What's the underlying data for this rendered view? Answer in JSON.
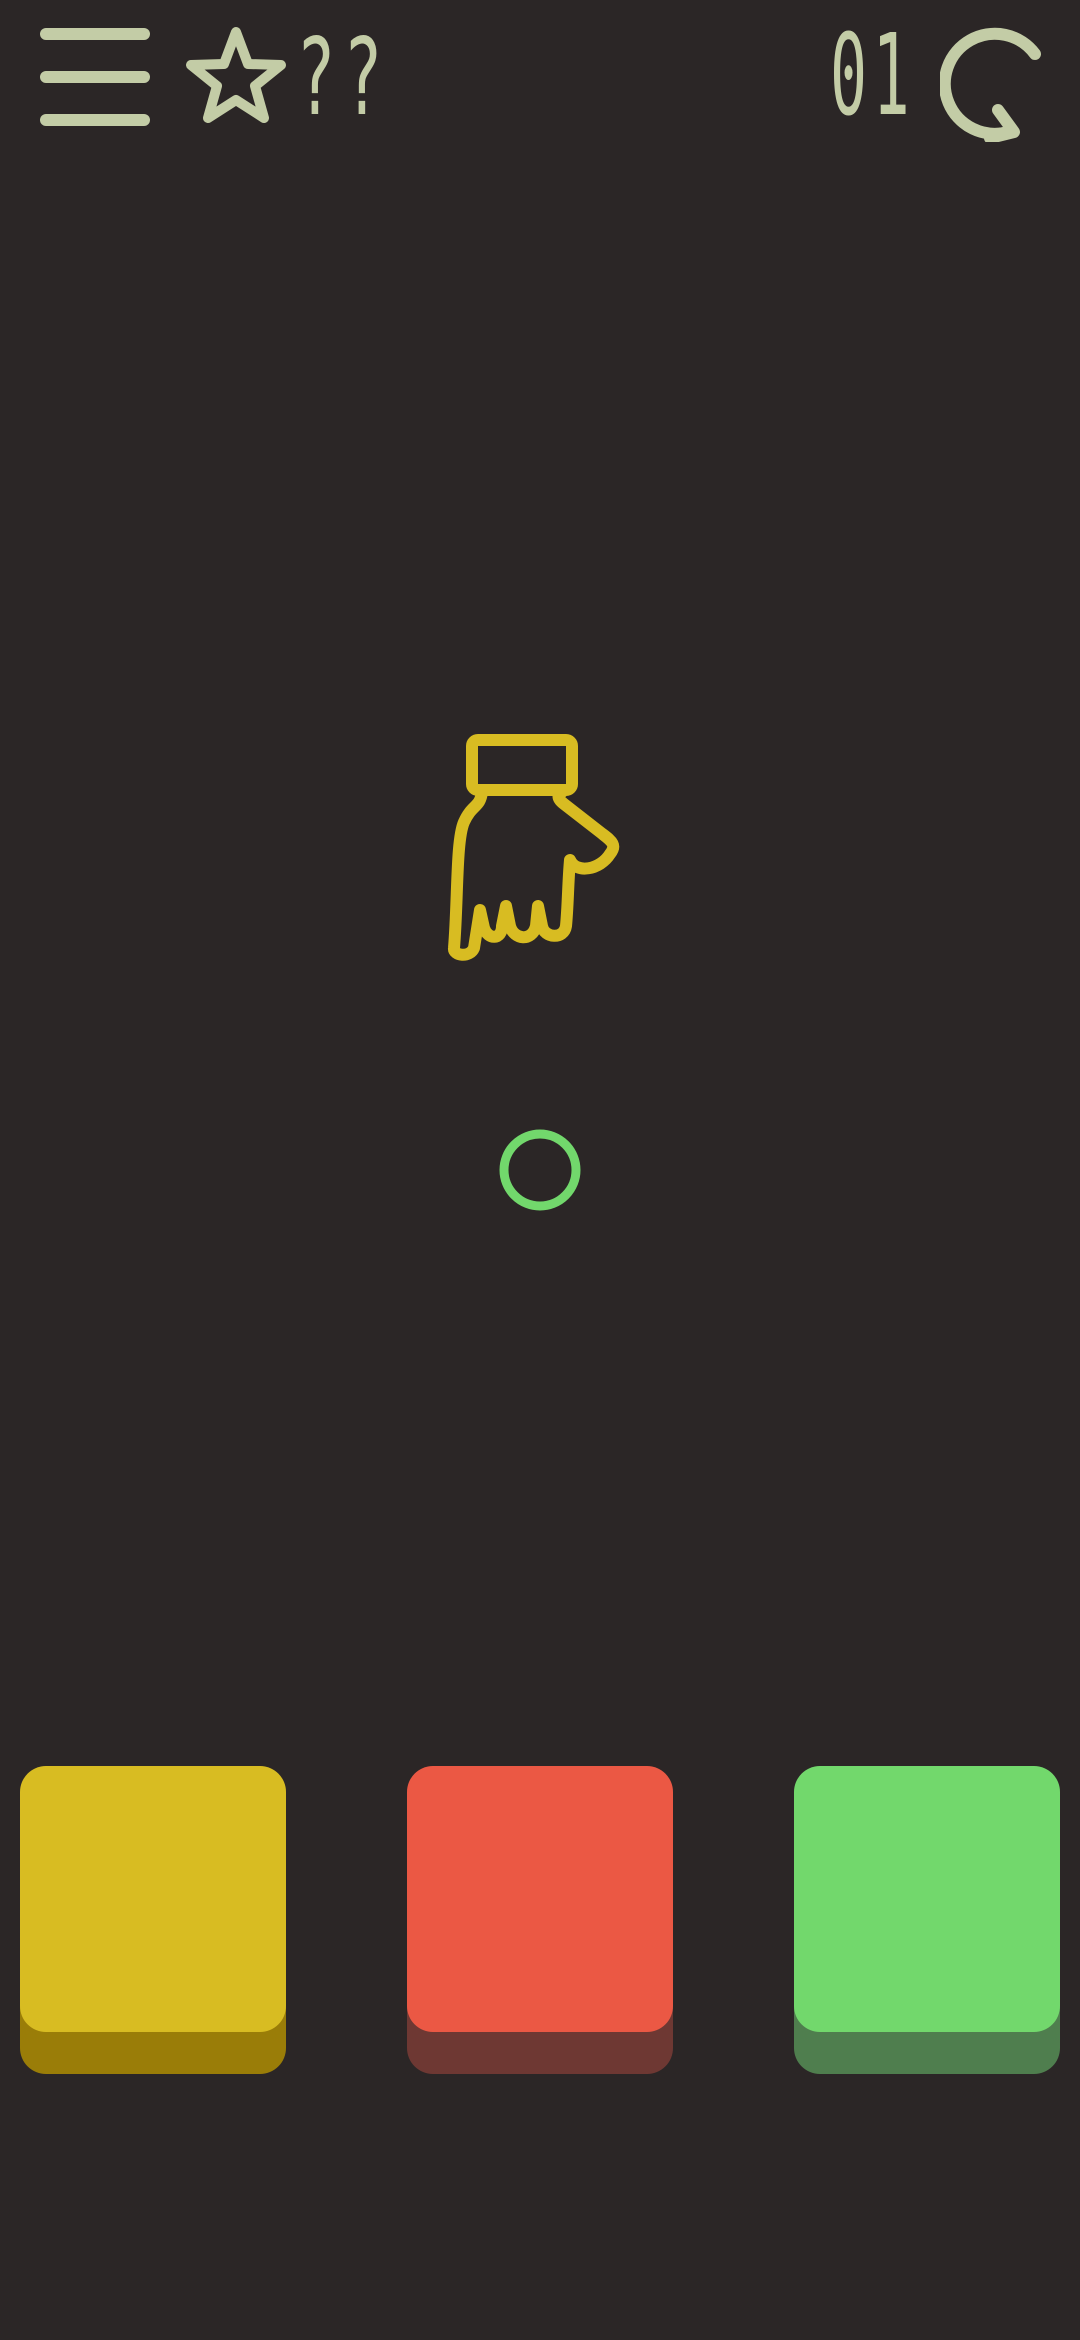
{
  "header": {
    "menu_icon": "hamburger-menu-icon",
    "star_icon": "star-outline-icon",
    "best_score": "??",
    "level": "01",
    "restart_icon": "restart-arrow-icon"
  },
  "stage": {
    "hand_icon": "pointing-down-hand-icon",
    "target_icon": "circle-outline-icon"
  },
  "buttons": [
    {
      "name": "yellow",
      "face_color": "#d8bc22",
      "shadow_color": "#9a7d08"
    },
    {
      "name": "red",
      "face_color": "#eb5844",
      "shadow_color": "#6e3833"
    },
    {
      "name": "green",
      "face_color": "#72d86c",
      "shadow_color": "#4f7e4e"
    }
  ],
  "colors": {
    "background": "#2b2626",
    "ui_accent": "#c3cca6",
    "hand": "#d8bc22",
    "target": "#72d86c"
  }
}
